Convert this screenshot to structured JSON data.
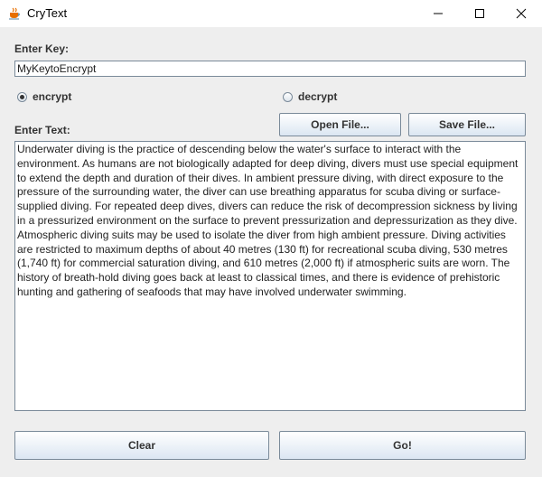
{
  "window": {
    "title": "CryText",
    "colors": {
      "border": "#7a8a99",
      "button_top": "#ffffff",
      "button_bottom": "#dbe6f2",
      "label": "#333333"
    }
  },
  "key": {
    "label": "Enter Key:",
    "value": "MyKeytoEncrypt"
  },
  "mode": {
    "encrypt_label": "encrypt",
    "decrypt_label": "decrypt",
    "selected": "encrypt"
  },
  "text": {
    "label": "Enter Text:",
    "value": "Underwater diving is the practice of descending below the water's surface to interact with the environment. As humans are not biologically adapted for deep diving, divers must use special equipment to extend the depth and duration of their dives. In ambient pressure diving, with direct exposure to the pressure of the surrounding water, the diver can use breathing apparatus for scuba diving or surface-supplied diving. For repeated deep dives, divers can reduce the risk of decompression sickness by living in a pressurized environment on the surface to prevent pressurization and depressurization as they dive. Atmospheric diving suits may be used to isolate the diver from high ambient pressure. Diving activities are restricted to maximum depths of about 40 metres (130 ft) for recreational scuba diving, 530 metres (1,740 ft) for commercial saturation diving, and 610 metres (2,000 ft) if atmospheric suits are worn. The history of breath-hold diving goes back at least to classical times, and there is evidence of prehistoric hunting and gathering of seafoods that may have involved underwater swimming."
  },
  "buttons": {
    "open_file": "Open File...",
    "save_file": "Save File...",
    "clear": "Clear",
    "go": "Go!"
  }
}
